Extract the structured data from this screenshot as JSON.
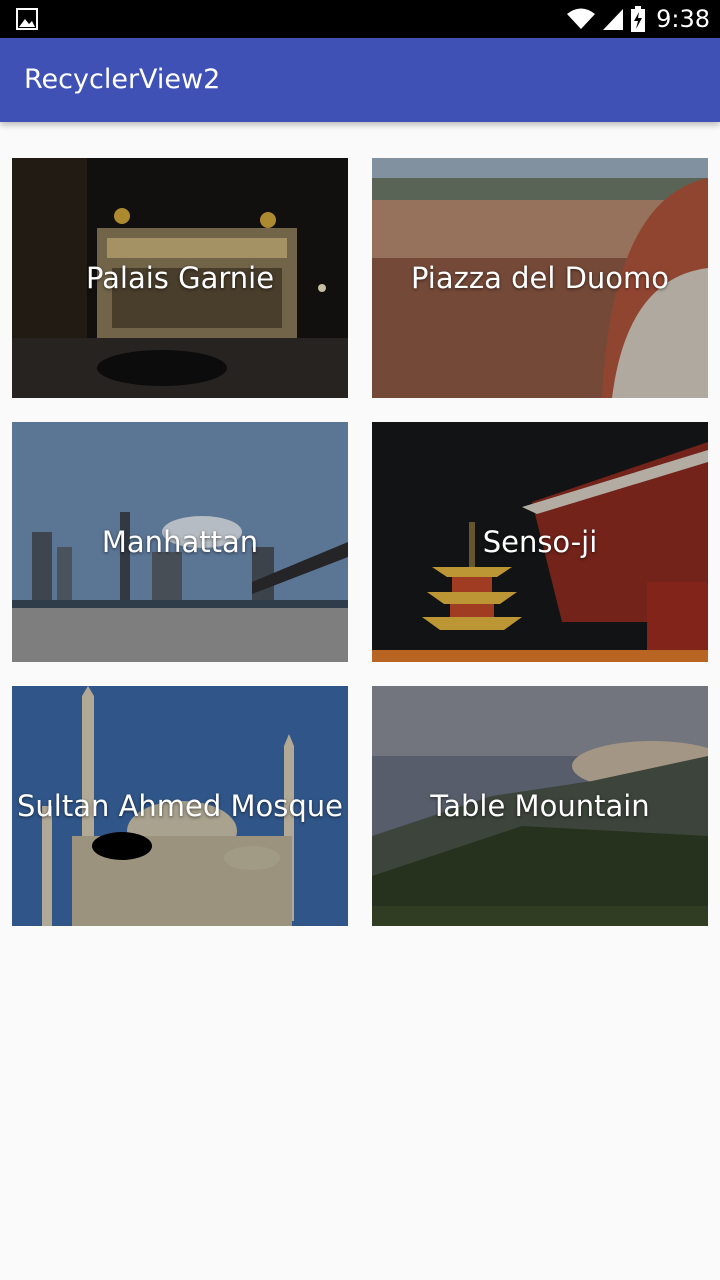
{
  "status_bar": {
    "time": "9:38",
    "left_icon": "image-icon",
    "icons": [
      "wifi-icon",
      "signal-icon",
      "battery-charging-icon"
    ]
  },
  "app_bar": {
    "title": "RecyclerView2",
    "color": "#3f51b5"
  },
  "places": [
    {
      "name": "Palais Garnie"
    },
    {
      "name": "Piazza del Duomo"
    },
    {
      "name": "Manhattan"
    },
    {
      "name": "Senso-ji"
    },
    {
      "name": "Sultan Ahmed Mosque"
    },
    {
      "name": "Table Mountain"
    }
  ]
}
